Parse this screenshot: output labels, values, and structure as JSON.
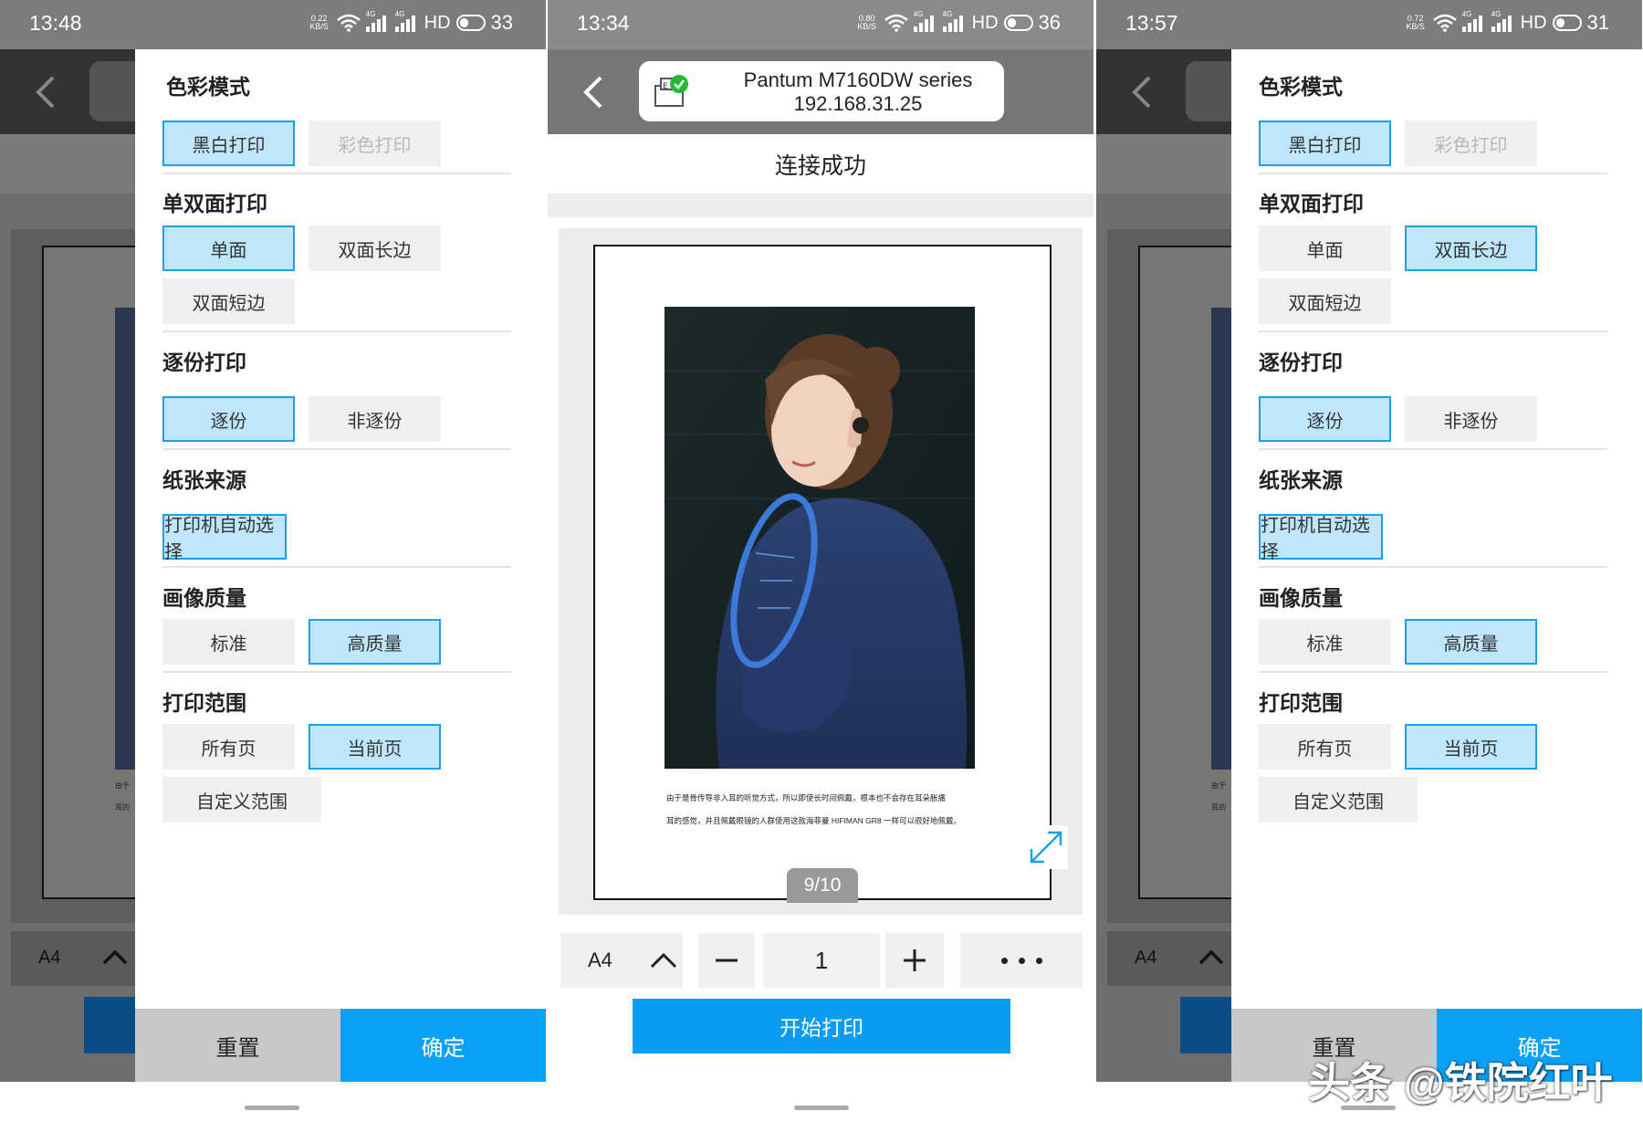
{
  "phones": [
    {
      "time": "13:48",
      "net_speed": [
        "0.22",
        "KB/S"
      ],
      "hd": "HD",
      "battery": "33",
      "signal_tag": "4G"
    },
    {
      "time": "13:34",
      "net_speed": [
        "0.80",
        "KB/S"
      ],
      "hd": "HD",
      "battery": "36",
      "signal_tag": "4G",
      "printer_name": "Pantum M7160DW series",
      "printer_ip": "192.168.31.25",
      "connection_status": "连接成功",
      "caption_lines": [
        "由于是骨传导非入耳的听觉方式，所以即使长时间佩戴，根本也不会存在耳朵胀痛",
        "耳的感觉，并且佩戴眼镜的人群使用这款海菲曼 HIFIMAN GR8 一样可以很好地佩戴。"
      ],
      "page_indicator": "9/10",
      "paper_size": "A4",
      "copies": "1",
      "start_print": "开始打印",
      "icons": [
        "back-icon",
        "printer-connected-icon",
        "expand-icon",
        "chevron-up-icon",
        "minus-icon",
        "plus-icon",
        "more-icon"
      ]
    },
    {
      "time": "13:57",
      "net_speed": [
        "0.72",
        "KB/S"
      ],
      "hd": "HD",
      "battery": "31",
      "signal_tag": "4G"
    }
  ],
  "background": {
    "paper_size": "A4",
    "tiny_text_1": "由于",
    "tiny_text_2": "耳的"
  },
  "settings": {
    "color_mode": {
      "title": "色彩模式",
      "bw": "黑白打印",
      "color": "彩色打印"
    },
    "duplex": {
      "title": "单双面打印",
      "single": "单面",
      "long_edge": "双面长边",
      "short_edge": "双面短边"
    },
    "collate": {
      "title": "逐份打印",
      "collate": "逐份",
      "no_collate": "非逐份"
    },
    "paper_source": {
      "title": "纸张来源",
      "auto": "打印机自动选择"
    },
    "quality": {
      "title": "画像质量",
      "standard": "标准",
      "high": "高质量"
    },
    "range": {
      "title": "打印范围",
      "all": "所有页",
      "current": "当前页",
      "custom": "自定义范围"
    },
    "reset": "重置",
    "confirm": "确定"
  },
  "colors": {
    "accent": "#0ba1f7",
    "selected_fill": "#bfe7fb",
    "selected_border": "#1a9fe8"
  },
  "watermark": "头条 @铁院红叶"
}
